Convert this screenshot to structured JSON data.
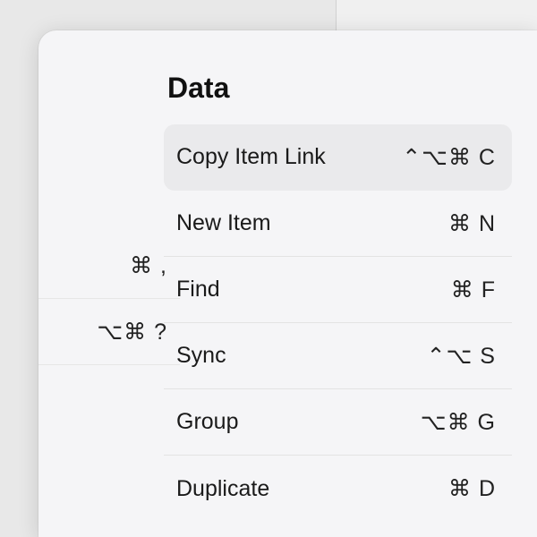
{
  "left_shortcuts": [
    {
      "text": "⌘ ,"
    },
    {
      "text": "⌥⌘ ?"
    }
  ],
  "section": {
    "title": "Data",
    "items": [
      {
        "label": "Copy Item Link",
        "shortcut": "⌃⌥⌘ C",
        "highlighted": true
      },
      {
        "label": "New Item",
        "shortcut": "⌘ N",
        "highlighted": false
      },
      {
        "label": "Find",
        "shortcut": "⌘ F",
        "highlighted": false
      },
      {
        "label": "Sync",
        "shortcut": "⌃⌥ S",
        "highlighted": false
      },
      {
        "label": "Group",
        "shortcut": "⌥⌘ G",
        "highlighted": false
      },
      {
        "label": "Duplicate",
        "shortcut": "⌘ D",
        "highlighted": false
      }
    ]
  }
}
